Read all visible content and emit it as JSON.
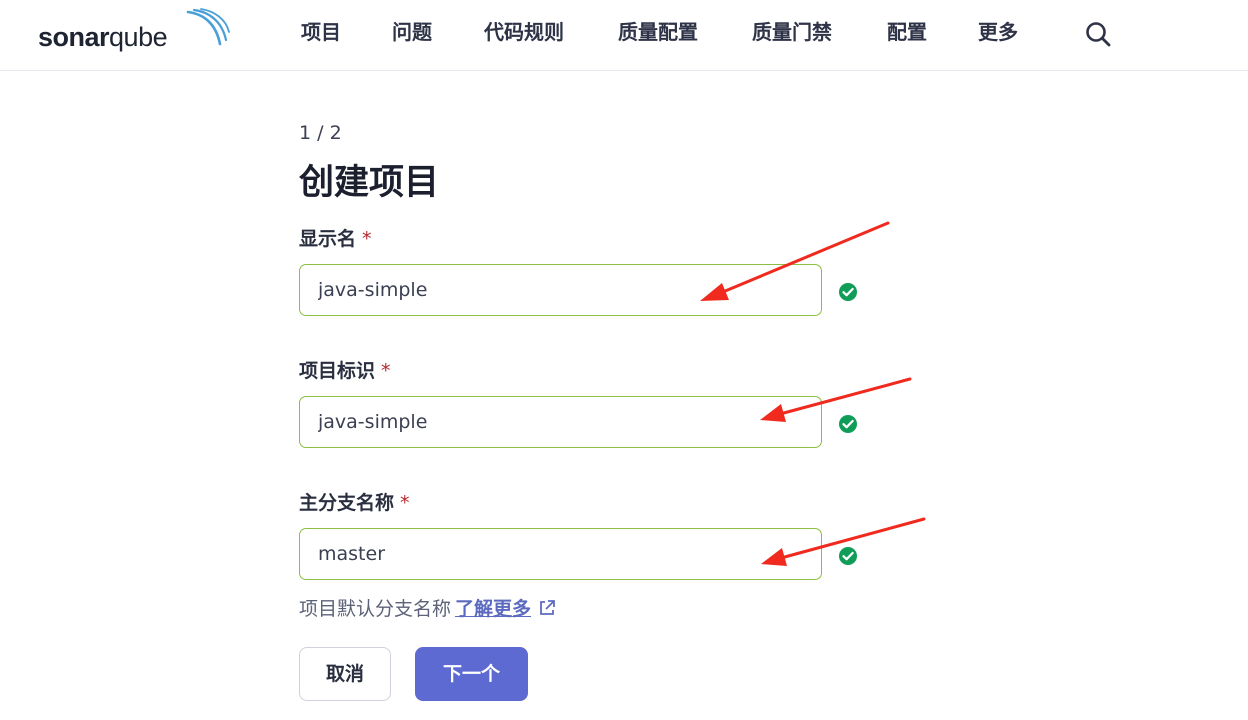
{
  "header": {
    "logo": {
      "bold": "sonar",
      "light": "qube"
    },
    "nav": [
      "项目",
      "问题",
      "代码规则",
      "质量配置",
      "质量门禁",
      "配置",
      "更多"
    ],
    "search_icon": "search-icon"
  },
  "form": {
    "step": "1 / 2",
    "title": "创建项目",
    "required_mark": "*",
    "display_name": {
      "label": "显示名",
      "value": "java-simple"
    },
    "project_key": {
      "label": "项目标识",
      "value": "java-simple"
    },
    "main_branch": {
      "label": "主分支名称",
      "value": "master"
    },
    "hint": {
      "text": "项目默认分支名称",
      "link": "了解更多"
    },
    "buttons": {
      "cancel": "取消",
      "next": "下一个"
    }
  },
  "colors": {
    "accent": "#5d6ad2",
    "valid_border": "#8ac03f",
    "valid_check": "#0f9d58",
    "annotation_arrow": "#f02a1e"
  }
}
